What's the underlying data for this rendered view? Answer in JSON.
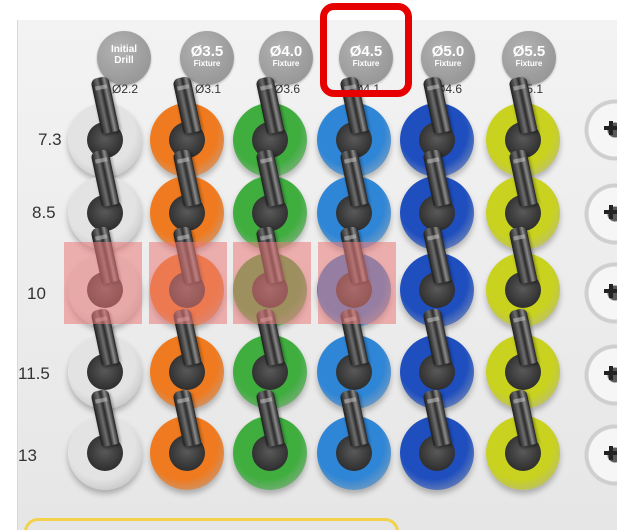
{
  "columns": [
    {
      "title": "Initial",
      "subtitle": "Drill",
      "diameter": "Ø2.2",
      "ring_color": "#e3e3e3"
    },
    {
      "title": "Ø3.5",
      "subtitle": "Fixture",
      "diameter": "Ø3.1",
      "ring_color": "#ef7a1f"
    },
    {
      "title": "Ø4.0",
      "subtitle": "Fixture",
      "diameter": "Ø3.6",
      "ring_color": "#3fae3f"
    },
    {
      "title": "Ø4.5",
      "subtitle": "Fixture",
      "diameter": "Ø4.1",
      "ring_color": "#2f86d6"
    },
    {
      "title": "Ø5.0",
      "subtitle": "Fixture",
      "diameter": "Ø4.6",
      "ring_color": "#1f4fbf"
    },
    {
      "title": "Ø5.5",
      "subtitle": "Fixture",
      "diameter": "Ø5.1",
      "ring_color": "#c9d21f"
    }
  ],
  "rows": [
    "7.3",
    "8.5",
    "10",
    "11.5",
    "13"
  ],
  "highlighted_row": "10",
  "highlighted_columns": [
    "Initial",
    "Ø3.5",
    "Ø4.0",
    "Ø4.5"
  ],
  "callout_column": "Ø4.5",
  "colors": {
    "callout_border": "#e60000",
    "highlight_fill": "#eb7878",
    "bottom_box_border": "#f2d24a",
    "badge_grey": "#9c9c9c"
  }
}
